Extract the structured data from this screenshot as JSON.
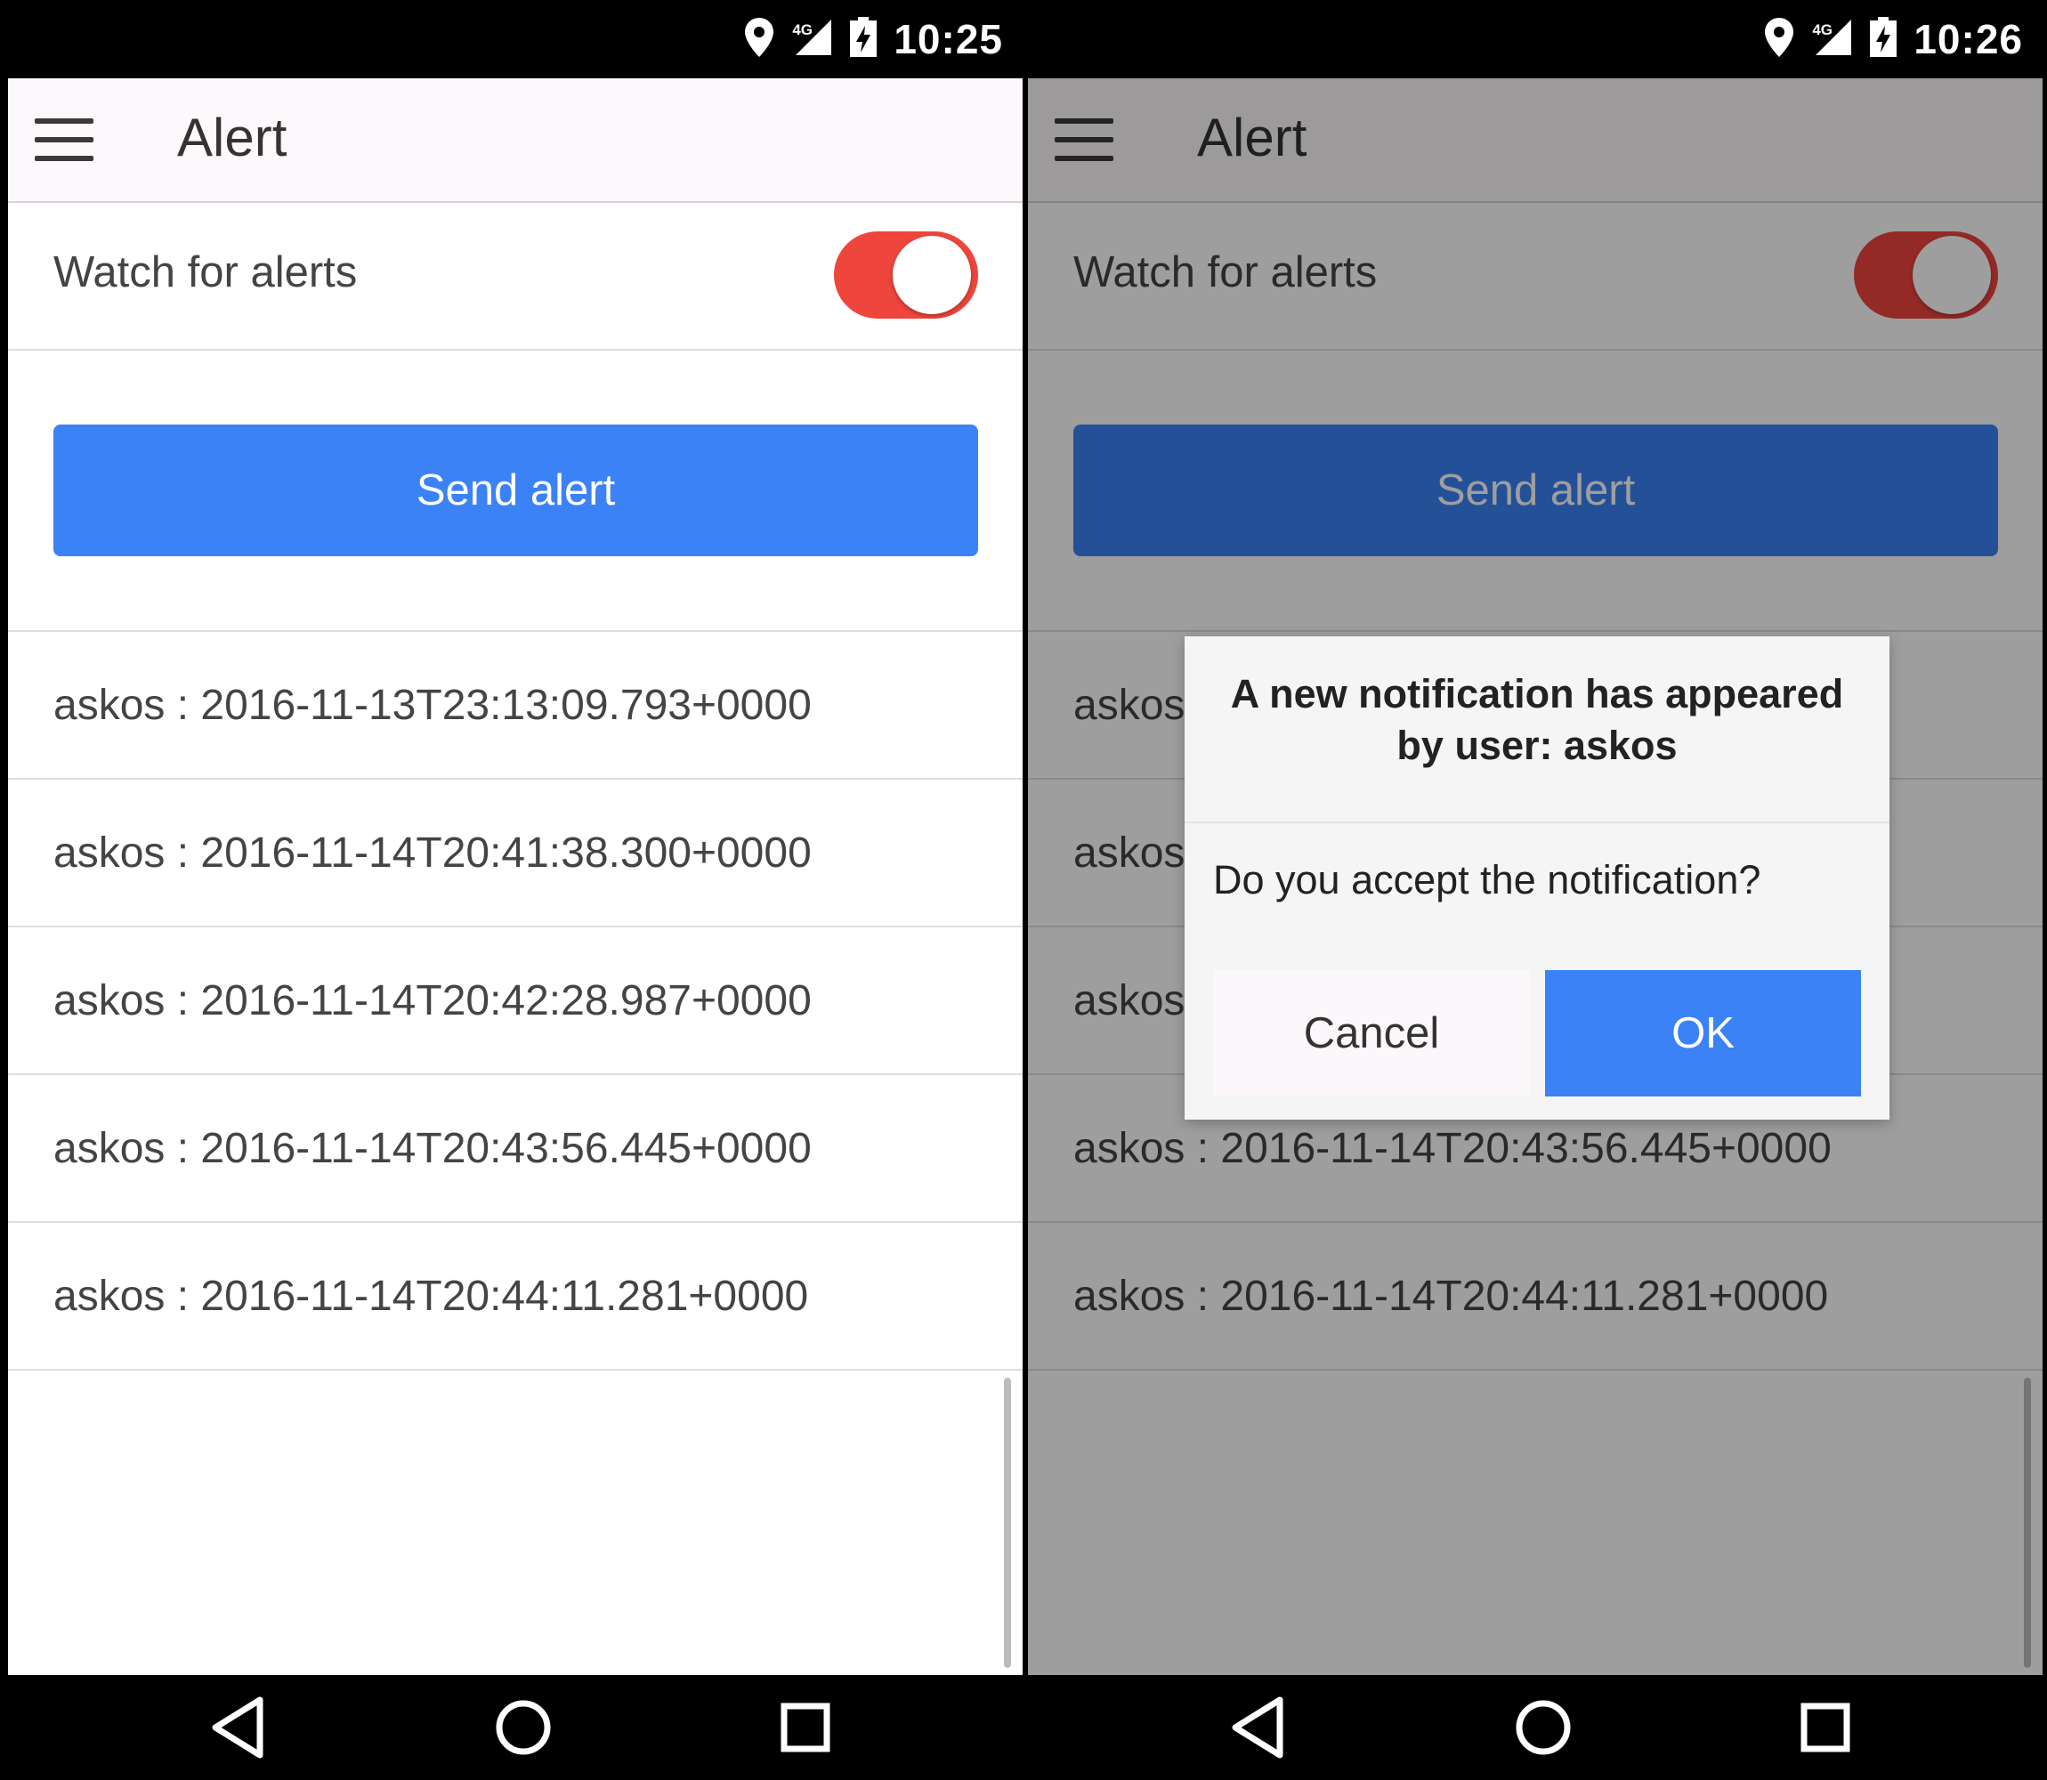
{
  "left_screen": {
    "status": {
      "time": "10:25",
      "network": "4G",
      "icons": [
        "location-icon",
        "signal-icon",
        "battery-icon"
      ]
    },
    "header": {
      "title": "Alert",
      "menu_icon": "hamburger-menu-icon"
    },
    "watch": {
      "label": "Watch for alerts",
      "enabled": true
    },
    "send_button": "Send alert",
    "alerts": [
      "askos : 2016-11-13T23:13:09.793+0000",
      "askos : 2016-11-14T20:41:38.300+0000",
      "askos : 2016-11-14T20:42:28.987+0000",
      "askos : 2016-11-14T20:43:56.445+0000",
      "askos : 2016-11-14T20:44:11.281+0000"
    ],
    "nav": [
      "back-icon",
      "home-icon",
      "recents-icon"
    ]
  },
  "right_screen": {
    "status": {
      "time": "10:26",
      "network": "4G",
      "icons": [
        "location-icon",
        "signal-icon",
        "battery-icon"
      ]
    },
    "header": {
      "title": "Alert",
      "menu_icon": "hamburger-menu-icon"
    },
    "watch": {
      "label": "Watch for alerts",
      "enabled": true
    },
    "send_button": "Send alert",
    "alerts": [
      "askos : 2016-11-13T23:13:09.793+0000",
      "askos : 2016-11-14T20:41:38.300+0000",
      "askos : 2016-11-14T20:42:28.987+0000",
      "askos : 2016-11-14T20:43:56.445+0000",
      "askos : 2016-11-14T20:44:11.281+0000"
    ],
    "dialog": {
      "title_line1": "A new notification has appeared",
      "title_line2": "by user: askos",
      "message": "Do you accept the notification?",
      "cancel": "Cancel",
      "ok": "OK"
    },
    "nav": [
      "back-icon",
      "home-icon",
      "recents-icon"
    ]
  },
  "colors": {
    "accent_blue": "#3b82f6",
    "toggle_red": "#ee453c",
    "header_bg": "#fdf8fc",
    "text": "#444444"
  }
}
